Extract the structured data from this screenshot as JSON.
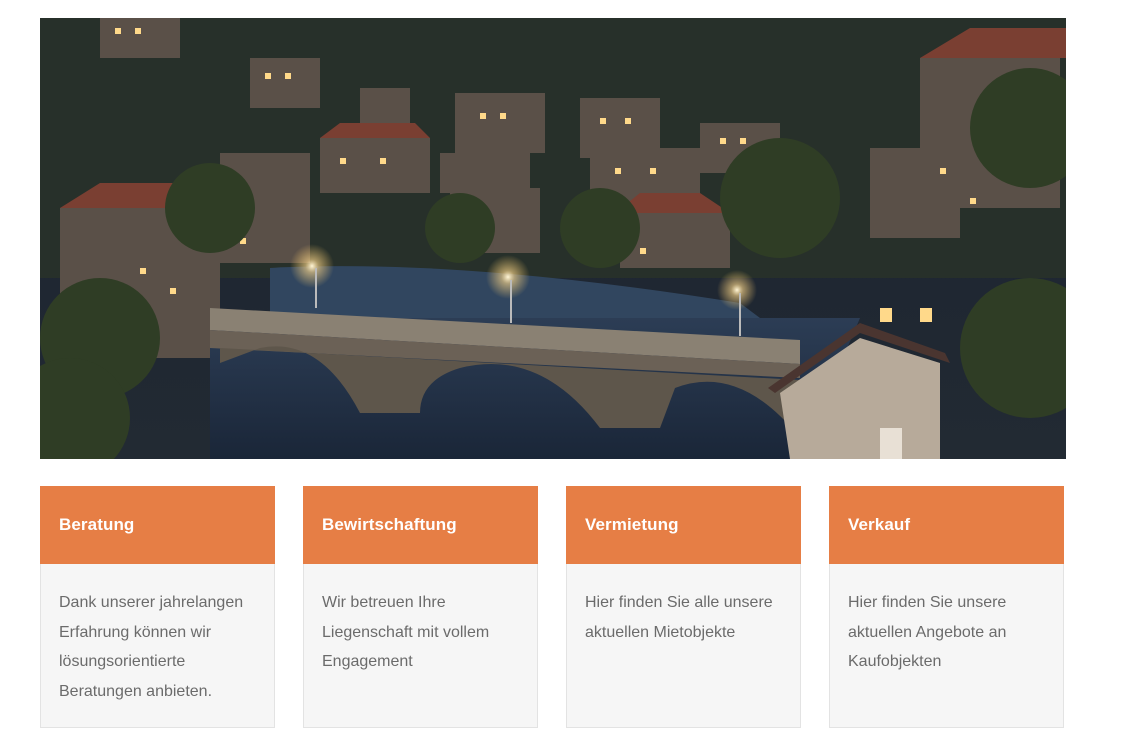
{
  "hero": {
    "image": "night-city-river-arched-bridge-photo"
  },
  "services": [
    {
      "title": "Beratung",
      "text": "Dank unserer jahrelangen Erfahrung können wir lösungsorientierte Beratungen anbieten."
    },
    {
      "title": "Bewirtschaftung",
      "text": "Wir betreuen Ihre Liegenschaft mit vollem Engagement"
    },
    {
      "title": "Vermietung",
      "text": "Hier finden Sie alle unsere aktuellen Mietobjekte"
    },
    {
      "title": "Verkauf",
      "text": "Hier finden Sie unsere aktuellen Angebote an Kaufobjekten"
    }
  ],
  "colors": {
    "accent": "#e67e45",
    "card_background": "#f6f6f6",
    "body_text": "#6b6b6b"
  }
}
